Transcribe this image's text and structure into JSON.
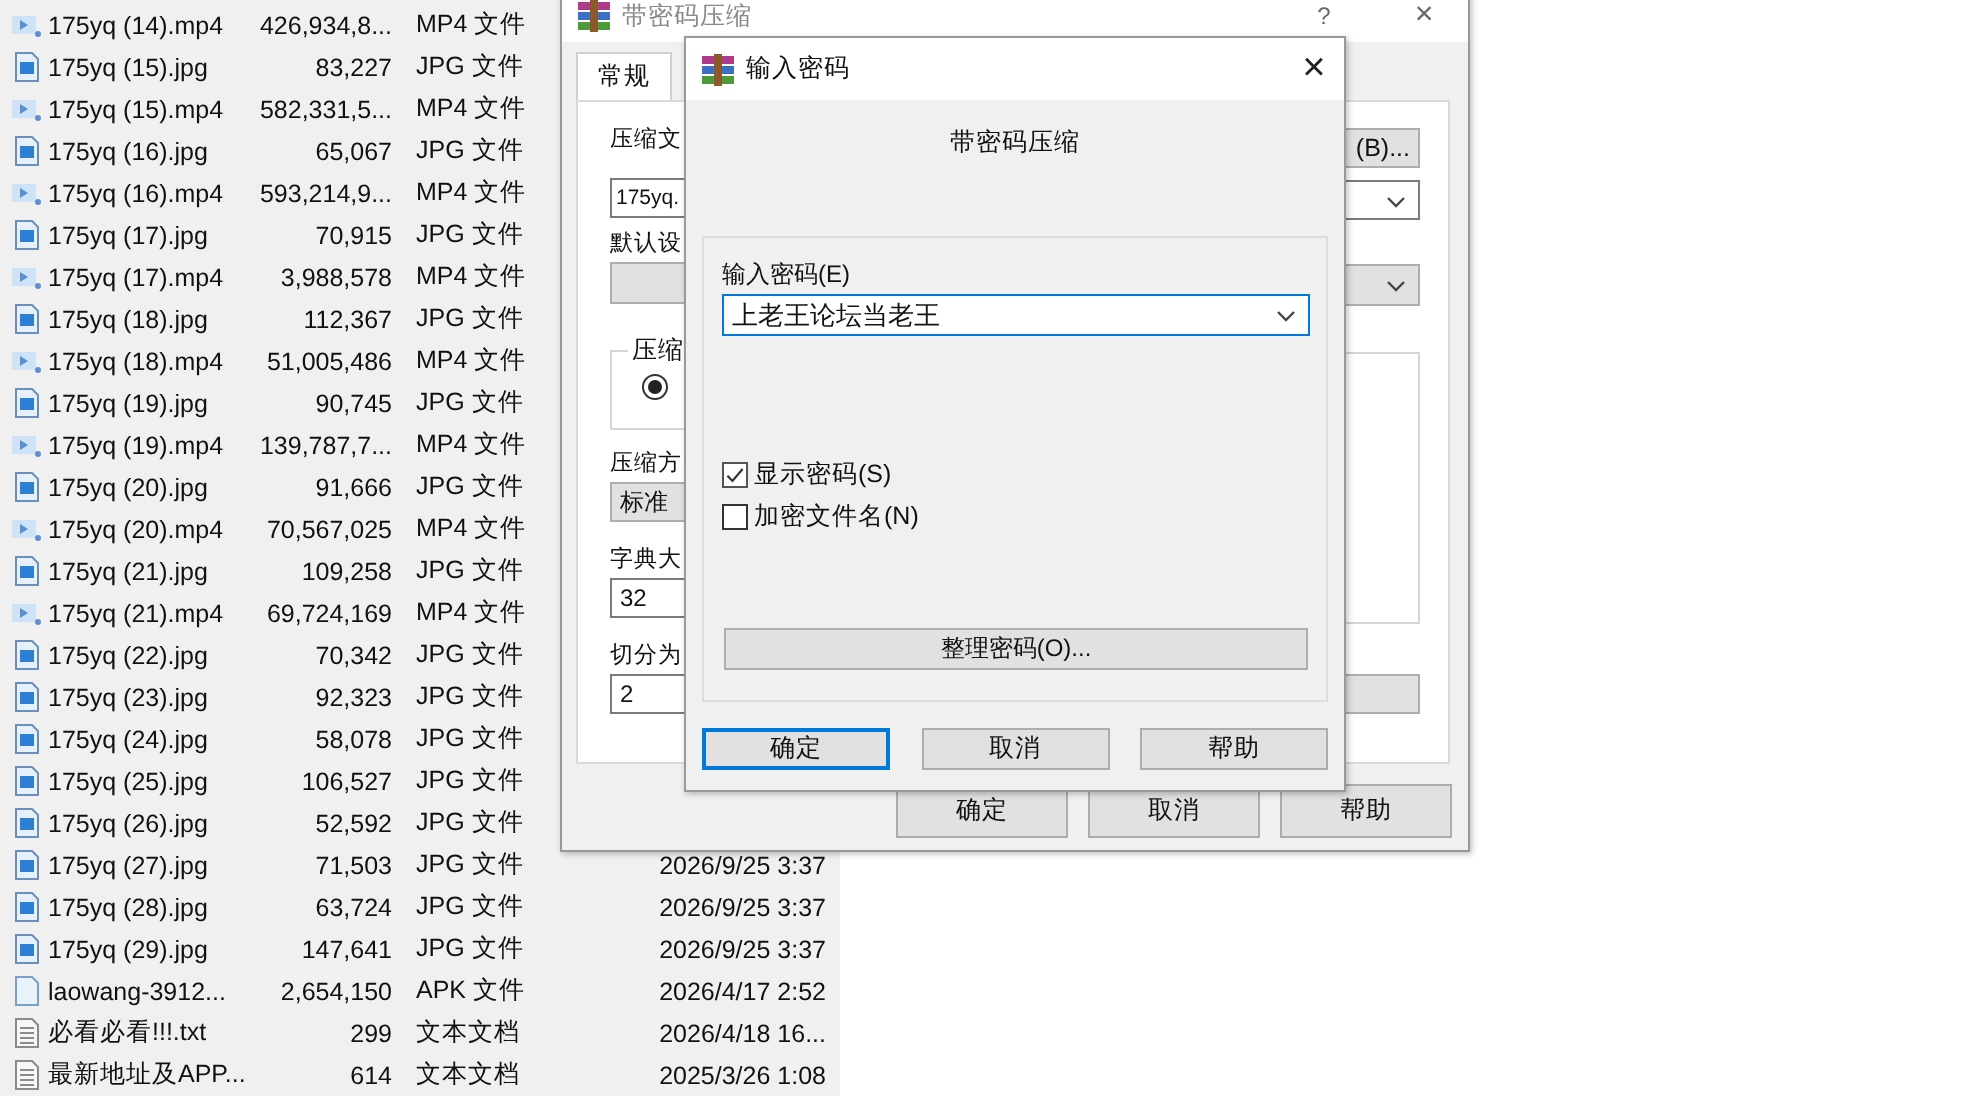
{
  "files": [
    {
      "kind": "video",
      "name": "175yq (14).mp4",
      "size": "426,934,8...",
      "type": "MP4 文件"
    },
    {
      "kind": "image",
      "name": "175yq (15).jpg",
      "size": "83,227",
      "type": "JPG 文件"
    },
    {
      "kind": "video",
      "name": "175yq (15).mp4",
      "size": "582,331,5...",
      "type": "MP4 文件"
    },
    {
      "kind": "image",
      "name": "175yq (16).jpg",
      "size": "65,067",
      "type": "JPG 文件"
    },
    {
      "kind": "video",
      "name": "175yq (16).mp4",
      "size": "593,214,9...",
      "type": "MP4 文件"
    },
    {
      "kind": "image",
      "name": "175yq (17).jpg",
      "size": "70,915",
      "type": "JPG 文件"
    },
    {
      "kind": "video",
      "name": "175yq (17).mp4",
      "size": "3,988,578",
      "type": "MP4 文件"
    },
    {
      "kind": "image",
      "name": "175yq (18).jpg",
      "size": "112,367",
      "type": "JPG 文件"
    },
    {
      "kind": "video",
      "name": "175yq (18).mp4",
      "size": "51,005,486",
      "type": "MP4 文件"
    },
    {
      "kind": "image",
      "name": "175yq (19).jpg",
      "size": "90,745",
      "type": "JPG 文件"
    },
    {
      "kind": "video",
      "name": "175yq (19).mp4",
      "size": "139,787,7...",
      "type": "MP4 文件"
    },
    {
      "kind": "image",
      "name": "175yq (20).jpg",
      "size": "91,666",
      "type": "JPG 文件"
    },
    {
      "kind": "video",
      "name": "175yq (20).mp4",
      "size": "70,567,025",
      "type": "MP4 文件"
    },
    {
      "kind": "image",
      "name": "175yq (21).jpg",
      "size": "109,258",
      "type": "JPG 文件"
    },
    {
      "kind": "video",
      "name": "175yq (21).mp4",
      "size": "69,724,169",
      "type": "MP4 文件"
    },
    {
      "kind": "image",
      "name": "175yq (22).jpg",
      "size": "70,342",
      "type": "JPG 文件"
    },
    {
      "kind": "image",
      "name": "175yq (23).jpg",
      "size": "92,323",
      "type": "JPG 文件"
    },
    {
      "kind": "image",
      "name": "175yq (24).jpg",
      "size": "58,078",
      "type": "JPG 文件"
    },
    {
      "kind": "image",
      "name": "175yq (25).jpg",
      "size": "106,527",
      "type": "JPG 文件"
    },
    {
      "kind": "image",
      "name": "175yq (26).jpg",
      "size": "52,592",
      "type": "JPG 文件"
    },
    {
      "kind": "image",
      "name": "175yq (27).jpg",
      "size": "71,503",
      "type": "JPG 文件",
      "date": "2026/9/25 3:37"
    },
    {
      "kind": "image",
      "name": "175yq (28).jpg",
      "size": "63,724",
      "type": "JPG 文件",
      "date": "2026/9/25 3:37"
    },
    {
      "kind": "image",
      "name": "175yq (29).jpg",
      "size": "147,641",
      "type": "JPG 文件",
      "date": "2026/9/25 3:37"
    },
    {
      "kind": "file",
      "name": "laowang-3912...",
      "size": "2,654,150",
      "type": "APK 文件",
      "date": "2026/4/17 2:52"
    },
    {
      "kind": "text",
      "name": "必看必看!!!.txt",
      "size": "299",
      "type": "文本文档",
      "date": "2026/4/18 16..."
    },
    {
      "kind": "text",
      "name": "最新地址及APP...",
      "size": "614",
      "type": "文本文档",
      "date": "2025/3/26 1:08"
    }
  ],
  "archive_dialog": {
    "title": "带密码压缩",
    "help_button": "?",
    "close_button": "×",
    "tabs": [
      {
        "label": "常规",
        "selected": true
      }
    ],
    "archive_label": "压缩文",
    "archive_name": "175yq.",
    "browse_button": "(B)...",
    "profile_label": "默认设",
    "format_group_label": "压缩",
    "format_radio": {
      "checked": true
    },
    "method_label": "压缩方",
    "method_value": "标准",
    "dictionary_label": "字典大",
    "dictionary_value": "32",
    "split_label": "切分为",
    "split_value": "2",
    "buttons": [
      "确定",
      "取消",
      "帮助"
    ]
  },
  "password_dialog": {
    "title": "输入密码",
    "close_button": "×",
    "heading": "带密码压缩",
    "password_label": "输入密码(E)",
    "password_value": "上老王论坛当老王",
    "options": [
      {
        "label": "显示密码(S)",
        "checked": true
      },
      {
        "label": "加密文件名(N)",
        "checked": false
      }
    ],
    "organize_button": "整理密码(O)...",
    "buttons": [
      {
        "label": "确定",
        "default": true
      },
      {
        "label": "取消",
        "default": false
      },
      {
        "label": "帮助",
        "default": false
      }
    ]
  }
}
